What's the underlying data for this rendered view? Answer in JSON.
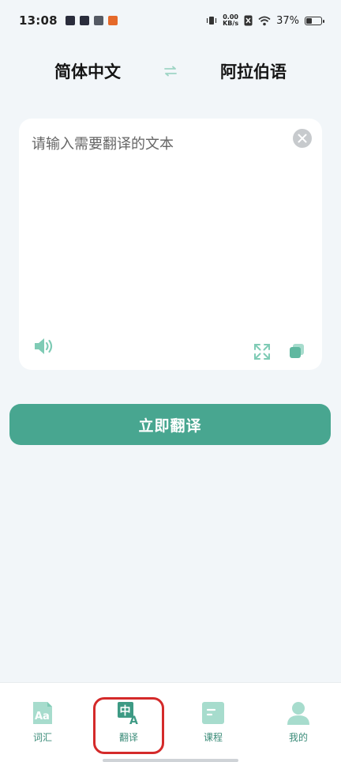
{
  "status_bar": {
    "time": "13:08",
    "speed_value": "0.00",
    "speed_unit": "KB/s",
    "battery": "37%",
    "battery_level": 0.37
  },
  "lang_bar": {
    "source": "简体中文",
    "target": "阿拉伯语",
    "swap_icon": "swap-arrows-icon"
  },
  "input": {
    "placeholder": "请输入需要翻译的文本",
    "value": ""
  },
  "actions": {
    "translate_label": "立即翻译"
  },
  "nav": {
    "items": [
      {
        "label": "词汇",
        "icon": "vocabulary-icon"
      },
      {
        "label": "翻译",
        "icon": "translate-icon"
      },
      {
        "label": "课程",
        "icon": "course-icon"
      },
      {
        "label": "我的",
        "icon": "profile-icon"
      }
    ],
    "active_index": 1
  },
  "colors": {
    "accent": "#48a690",
    "accent_light": "#9fd5c5",
    "highlight": "#d42a2a",
    "background": "#f2f6f9"
  }
}
